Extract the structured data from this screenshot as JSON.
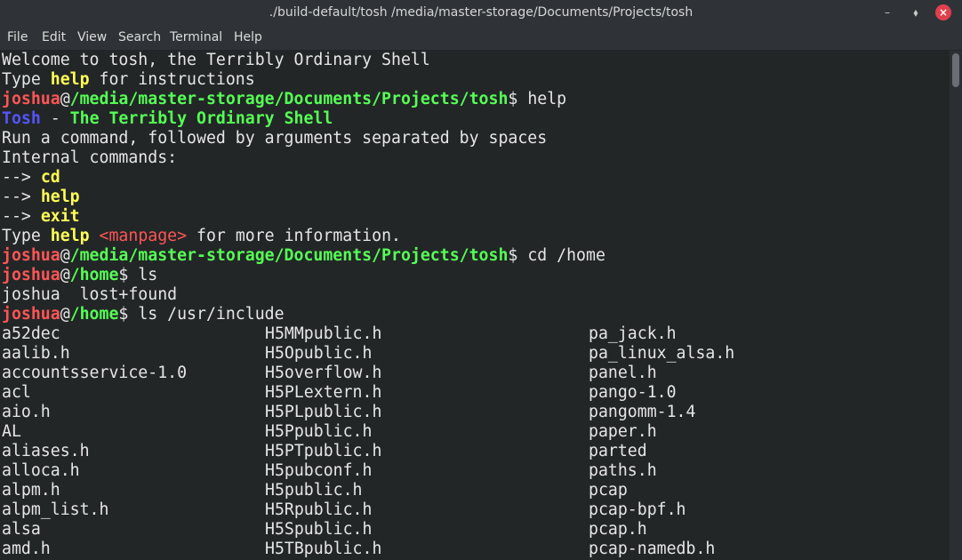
{
  "window": {
    "title": "./build-default/tosh  /media/master-storage/Documents/Projects/tosh",
    "controls": {
      "minimize": "–",
      "maximize": "⬧",
      "close": "×"
    }
  },
  "menu": [
    "File",
    "Edit",
    "View",
    "Search",
    "Terminal",
    "Help"
  ],
  "terminal": {
    "welcome": "Welcome to tosh, the Terribly Ordinary Shell",
    "type_word": "Type ",
    "help_word": "help",
    "for_instructions": " for instructions",
    "user": "joshua",
    "at": "@",
    "path_projects": "/media/master-storage/Documents/Projects/tosh",
    "path_home": "/home",
    "prompt": "$ ",
    "cmd_help": "help",
    "tosh_name": "Tosh",
    "dash": " - ",
    "tosh_full": "The Terribly Ordinary Shell",
    "run_text": "Run a command, followed by arguments separated by spaces",
    "internal": "Internal commands:",
    "arrow": "--> ",
    "internal_cmds": [
      "cd",
      "help",
      "exit"
    ],
    "manpage_space": " ",
    "manpage": "<manpage>",
    "more_info": " for more information.",
    "cmd_cd": "cd /home",
    "cmd_ls": "ls",
    "ls_output": "joshua  lost+found",
    "cmd_ls_include": "ls /usr/include",
    "listing": {
      "col1": [
        "a52dec",
        "aalib.h",
        "accountsservice-1.0",
        "acl",
        "aio.h",
        "AL",
        "aliases.h",
        "alloca.h",
        "alpm.h",
        "alpm_list.h",
        "alsa",
        "amd.h"
      ],
      "col2": [
        "H5MMpublic.h",
        "H5Opublic.h",
        "H5overflow.h",
        "H5PLextern.h",
        "H5PLpublic.h",
        "H5Ppublic.h",
        "H5PTpublic.h",
        "H5pubconf.h",
        "H5public.h",
        "H5Rpublic.h",
        "H5Spublic.h",
        "H5TBpublic.h"
      ],
      "col3": [
        "pa_jack.h",
        "pa_linux_alsa.h",
        "panel.h",
        "pango-1.0",
        "pangomm-1.4",
        "paper.h",
        "parted",
        "paths.h",
        "pcap",
        "pcap-bpf.h",
        "pcap.h",
        "pcap-namedb.h"
      ]
    }
  },
  "colors": {
    "background": "#232627",
    "text": "#e6e6e6",
    "user": "#ff5555",
    "path": "#55ff55",
    "highlight": "#ffff55",
    "tosh": "#5555ff",
    "close_button": "#e0404d"
  }
}
